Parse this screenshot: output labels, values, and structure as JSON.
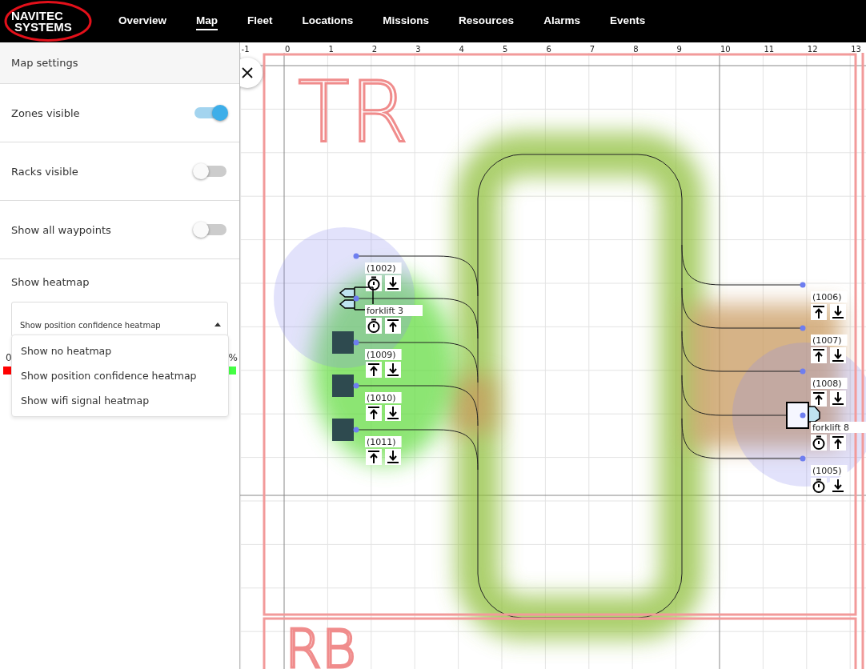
{
  "logo": {
    "line1": "NAVITEC",
    "line2": "SYSTEMS"
  },
  "nav": [
    {
      "label": "Overview",
      "selected": false
    },
    {
      "label": "Map",
      "selected": true
    },
    {
      "label": "Fleet",
      "selected": false
    },
    {
      "label": "Locations",
      "selected": false
    },
    {
      "label": "Missions",
      "selected": false
    },
    {
      "label": "Resources",
      "selected": false
    },
    {
      "label": "Alarms",
      "selected": false
    },
    {
      "label": "Events",
      "selected": false
    }
  ],
  "sidebar": {
    "title": "Map settings",
    "toggles": [
      {
        "label": "Zones visible",
        "on": true
      },
      {
        "label": "Racks visible",
        "on": false
      },
      {
        "label": "Show all waypoints",
        "on": false
      }
    ],
    "heatmap": {
      "label": "Show heatmap",
      "value": "Show position confidence heatmap",
      "expanded": true,
      "options": [
        "Show no heatmap",
        "Show position confidence heatmap",
        "Show wifi signal heatmap"
      ],
      "legend_min": "0",
      "legend_max": "%"
    }
  },
  "map": {
    "x_ticks": [
      "-1",
      "0",
      "1",
      "2",
      "3",
      "4",
      "5",
      "6",
      "7",
      "8",
      "9",
      "10",
      "11",
      "12",
      "13"
    ],
    "zones": [
      "TR",
      "RB"
    ],
    "locations": [
      {
        "kind": "location",
        "label": "(1002)",
        "actions": [
          {
            "kind": "timer"
          },
          {
            "kind": "unload"
          }
        ]
      },
      {
        "kind": "forklift",
        "label": "forklift 3",
        "actions": [
          {
            "kind": "timer"
          },
          {
            "kind": "load"
          }
        ]
      },
      {
        "kind": "rack",
        "label": "(1009)",
        "actions": [
          {
            "kind": "load"
          },
          {
            "kind": "unload"
          }
        ]
      },
      {
        "kind": "rack",
        "label": "(1010)",
        "actions": [
          {
            "kind": "load"
          },
          {
            "kind": "unload"
          }
        ]
      },
      {
        "kind": "rack",
        "label": "(1011)",
        "actions": [
          {
            "kind": "load"
          },
          {
            "kind": "unload"
          }
        ]
      },
      {
        "kind": "location",
        "label": "(1006)",
        "actions": [
          {
            "kind": "load"
          },
          {
            "kind": "unload"
          }
        ]
      },
      {
        "kind": "location",
        "label": "(1007)",
        "actions": [
          {
            "kind": "load"
          },
          {
            "kind": "unload"
          }
        ]
      },
      {
        "kind": "location",
        "label": "(1008)",
        "actions": [
          {
            "kind": "load"
          },
          {
            "kind": "unload"
          }
        ]
      },
      {
        "kind": "forklift",
        "label": "forklift 8",
        "actions": [
          {
            "kind": "timer"
          },
          {
            "kind": "load"
          }
        ]
      },
      {
        "kind": "location",
        "label": "(1005)",
        "actions": [
          {
            "kind": "timer"
          },
          {
            "kind": "unload"
          }
        ]
      }
    ]
  }
}
